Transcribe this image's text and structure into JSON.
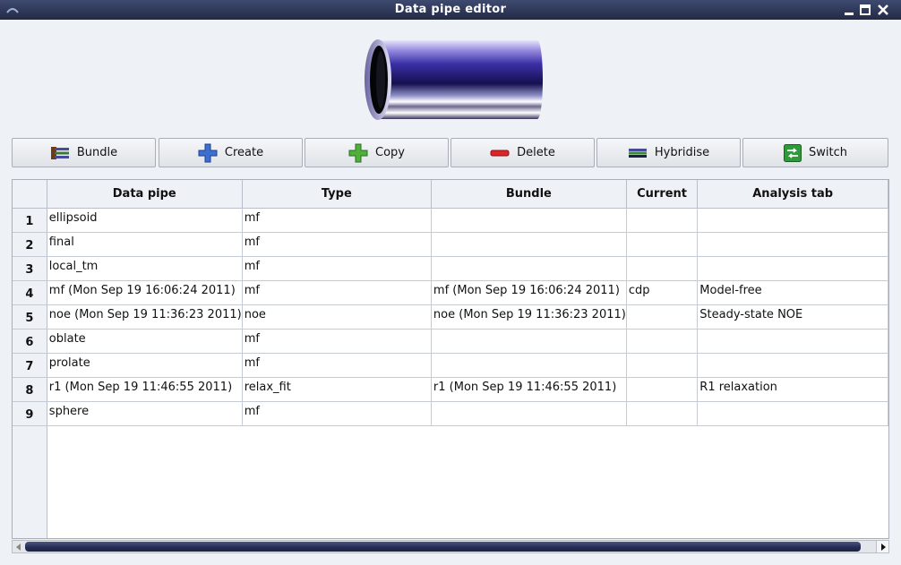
{
  "window": {
    "title": "Data pipe editor"
  },
  "toolbar": {
    "buttons": [
      {
        "label": "Bundle",
        "icon": "bundle-icon"
      },
      {
        "label": "Create",
        "icon": "plus-icon"
      },
      {
        "label": "Copy",
        "icon": "copy-plus-icon"
      },
      {
        "label": "Delete",
        "icon": "minus-icon"
      },
      {
        "label": "Hybridise",
        "icon": "hybridise-icon"
      },
      {
        "label": "Switch",
        "icon": "switch-icon"
      }
    ]
  },
  "table": {
    "columns": [
      "Data pipe",
      "Type",
      "Bundle",
      "Current",
      "Analysis tab"
    ],
    "rows": [
      {
        "num": "1",
        "cells": [
          "ellipsoid",
          "mf",
          "",
          "",
          ""
        ]
      },
      {
        "num": "2",
        "cells": [
          "final",
          "mf",
          "",
          "",
          ""
        ]
      },
      {
        "num": "3",
        "cells": [
          "local_tm",
          "mf",
          "",
          "",
          ""
        ]
      },
      {
        "num": "4",
        "cells": [
          "mf (Mon Sep 19 16:06:24 2011)",
          "mf",
          "mf (Mon Sep 19 16:06:24 2011)",
          "cdp",
          "Model-free"
        ]
      },
      {
        "num": "5",
        "cells": [
          "noe (Mon Sep 19 11:36:23 2011)",
          "noe",
          "noe (Mon Sep 19 11:36:23 2011)",
          "",
          "Steady-state NOE"
        ]
      },
      {
        "num": "6",
        "cells": [
          "oblate",
          "mf",
          "",
          "",
          ""
        ]
      },
      {
        "num": "7",
        "cells": [
          "prolate",
          "mf",
          "",
          "",
          ""
        ]
      },
      {
        "num": "8",
        "cells": [
          "r1 (Mon Sep 19 11:46:55 2011)",
          "relax_fit",
          "r1 (Mon Sep 19 11:46:55 2011)",
          "",
          "R1 relaxation"
        ]
      },
      {
        "num": "9",
        "cells": [
          "sphere",
          "mf",
          "",
          "",
          ""
        ]
      }
    ]
  },
  "colors": {
    "titlebar": "#2b3352",
    "accent": "#5a4fb0",
    "background": "#eef1f6"
  }
}
